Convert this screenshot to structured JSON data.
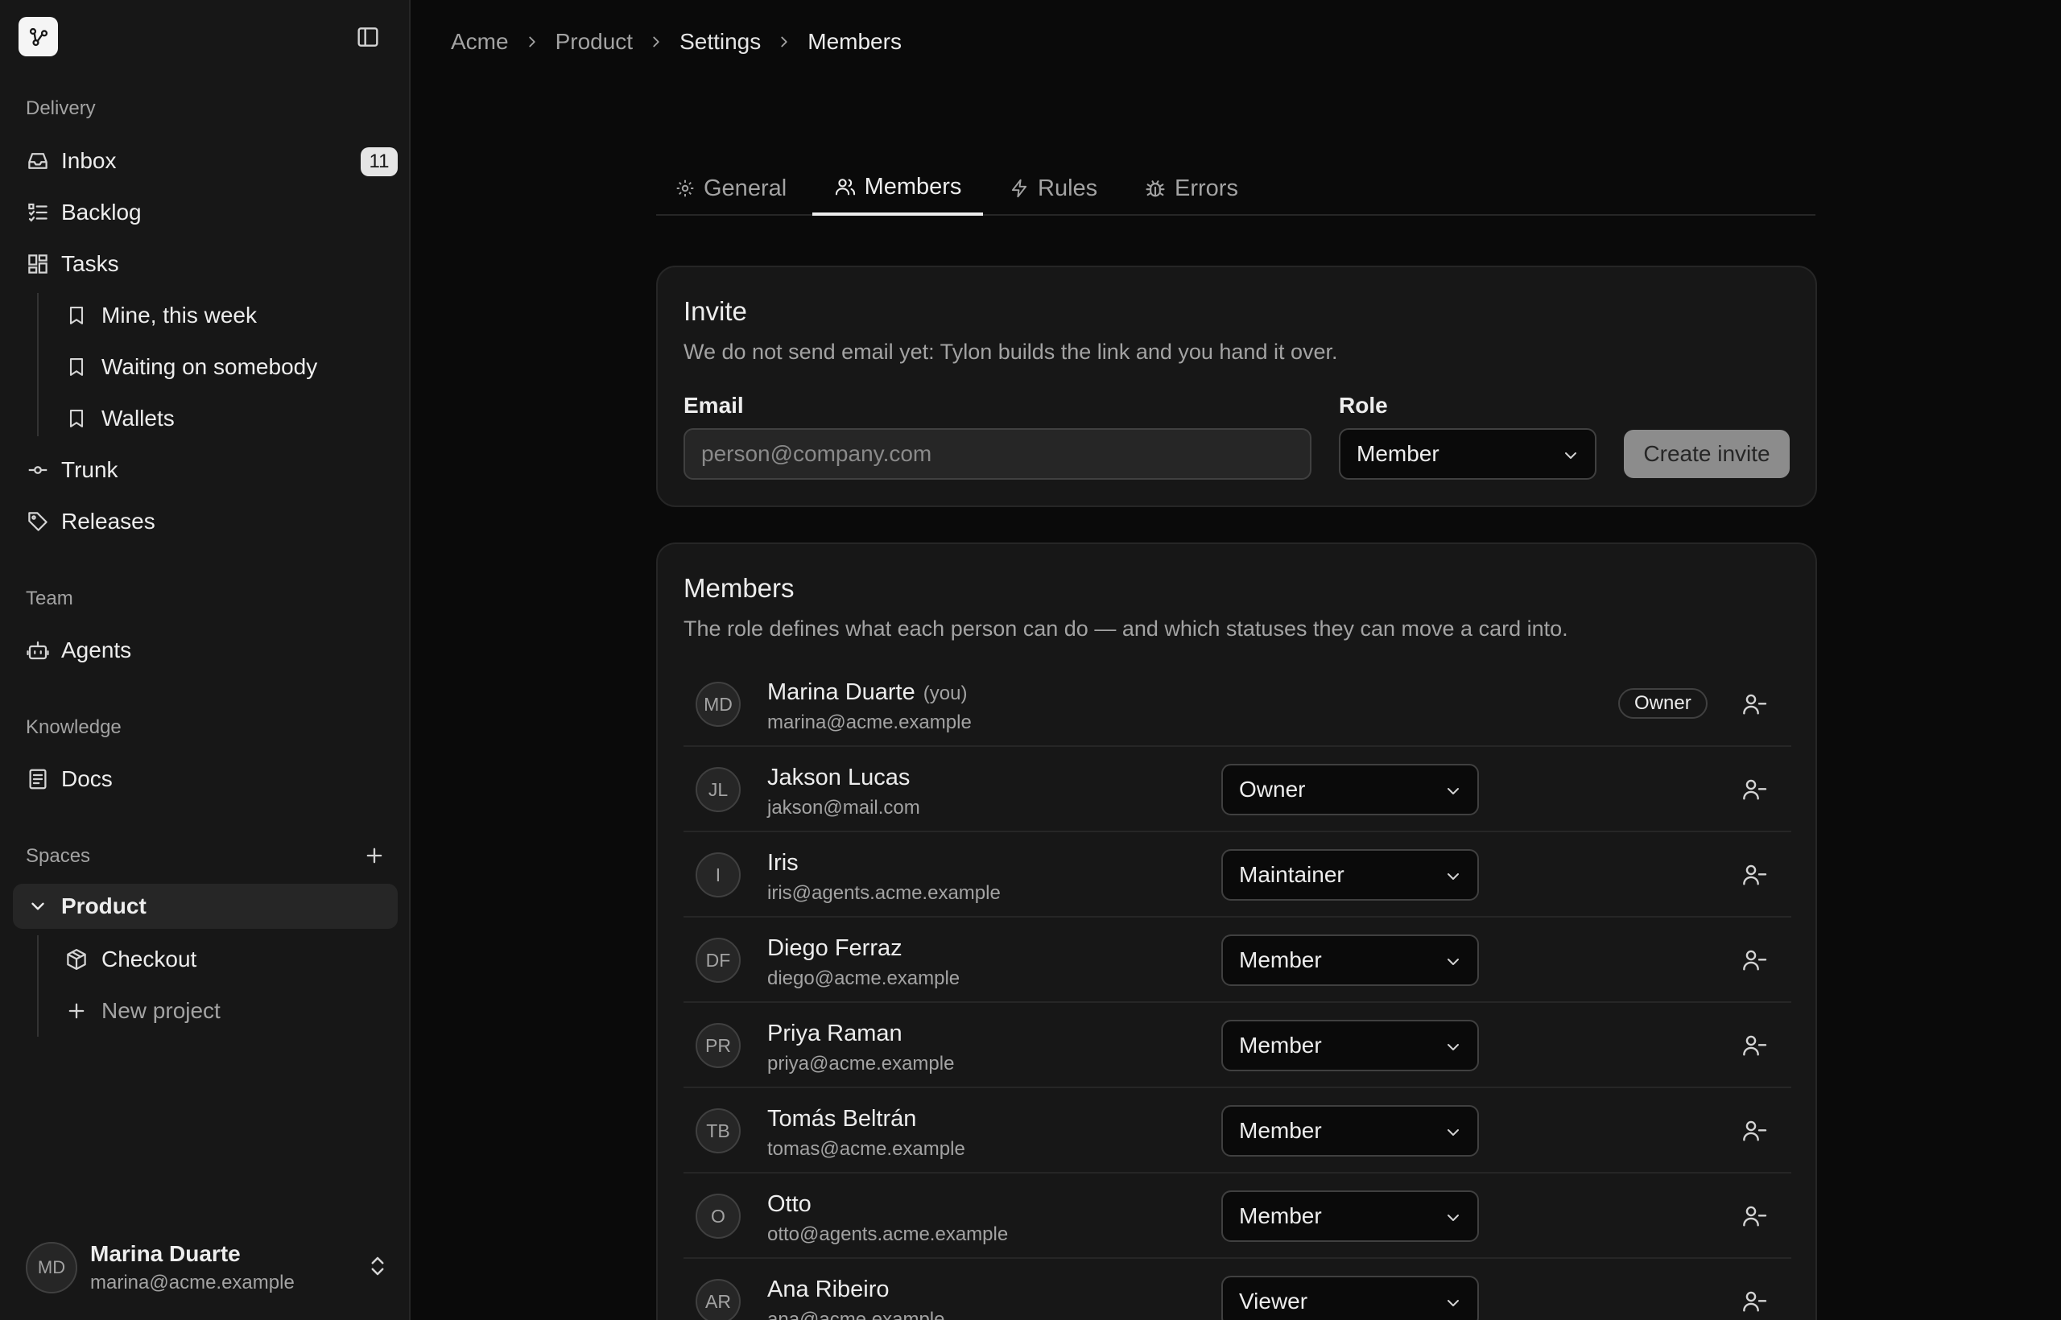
{
  "sidebar": {
    "sections": {
      "delivery": "Delivery",
      "team": "Team",
      "knowledge": "Knowledge",
      "spaces": "Spaces"
    },
    "items": {
      "inbox": "Inbox",
      "inbox_count": "11",
      "backlog": "Backlog",
      "tasks": "Tasks",
      "mine": "Mine, this week",
      "waiting": "Waiting on somebody",
      "wallets": "Wallets",
      "trunk": "Trunk",
      "releases": "Releases",
      "agents": "Agents",
      "docs": "Docs",
      "product": "Product",
      "checkout": "Checkout",
      "new_project": "New project"
    },
    "user": {
      "initials": "MD",
      "name": "Marina Duarte",
      "email": "marina@acme.example"
    }
  },
  "breadcrumb": [
    "Acme",
    "Product",
    "Settings",
    "Members"
  ],
  "tabs": [
    "General",
    "Members",
    "Rules",
    "Errors"
  ],
  "active_tab": "Members",
  "invite": {
    "title": "Invite",
    "description": "We do not send email yet: Tylon builds the link and you hand it over.",
    "email_label": "Email",
    "email_placeholder": "person@company.com",
    "role_label": "Role",
    "role_value": "Member",
    "create_button": "Create invite"
  },
  "members": {
    "title": "Members",
    "description": "The role defines what each person can do — and which statuses they can move a card into.",
    "you_label": "(you)",
    "rows": [
      {
        "initials": "MD",
        "name": "Marina Duarte",
        "email": "marina@acme.example",
        "role": "Owner",
        "is_you": true
      },
      {
        "initials": "JL",
        "name": "Jakson Lucas",
        "email": "jakson@mail.com",
        "role": "Owner"
      },
      {
        "initials": "I",
        "name": "Iris",
        "email": "iris@agents.acme.example",
        "role": "Maintainer"
      },
      {
        "initials": "DF",
        "name": "Diego Ferraz",
        "email": "diego@acme.example",
        "role": "Member"
      },
      {
        "initials": "PR",
        "name": "Priya Raman",
        "email": "priya@acme.example",
        "role": "Member"
      },
      {
        "initials": "TB",
        "name": "Tomás Beltrán",
        "email": "tomas@acme.example",
        "role": "Member"
      },
      {
        "initials": "O",
        "name": "Otto",
        "email": "otto@agents.acme.example",
        "role": "Member"
      },
      {
        "initials": "AR",
        "name": "Ana Ribeiro",
        "email": "ana@acme.example",
        "role": "Viewer"
      }
    ]
  },
  "colors": {
    "background": "#0a0a0a",
    "sidebar": "#171717",
    "card": "#171717",
    "border": "#262626",
    "text": "#ededed",
    "muted": "#a3a3a3",
    "button": "#8c8c8c"
  },
  "icons": {
    "logo": "branch-logo-icon",
    "collapse": "sidebar-toggle-icon",
    "inbox": "inbox-icon",
    "backlog": "list-checks-icon",
    "tasks": "grid-icon",
    "view": "bookmark-icon",
    "trunk": "commit-icon",
    "releases": "tag-icon",
    "agents": "bot-icon",
    "docs": "document-icon",
    "product": "chevron-down-icon",
    "checkout": "package-icon",
    "new_project": "plus-icon",
    "general_tab": "gear-icon",
    "members_tab": "users-icon",
    "rules_tab": "zap-icon",
    "errors_tab": "bug-icon",
    "remove_member": "user-minus-icon"
  }
}
